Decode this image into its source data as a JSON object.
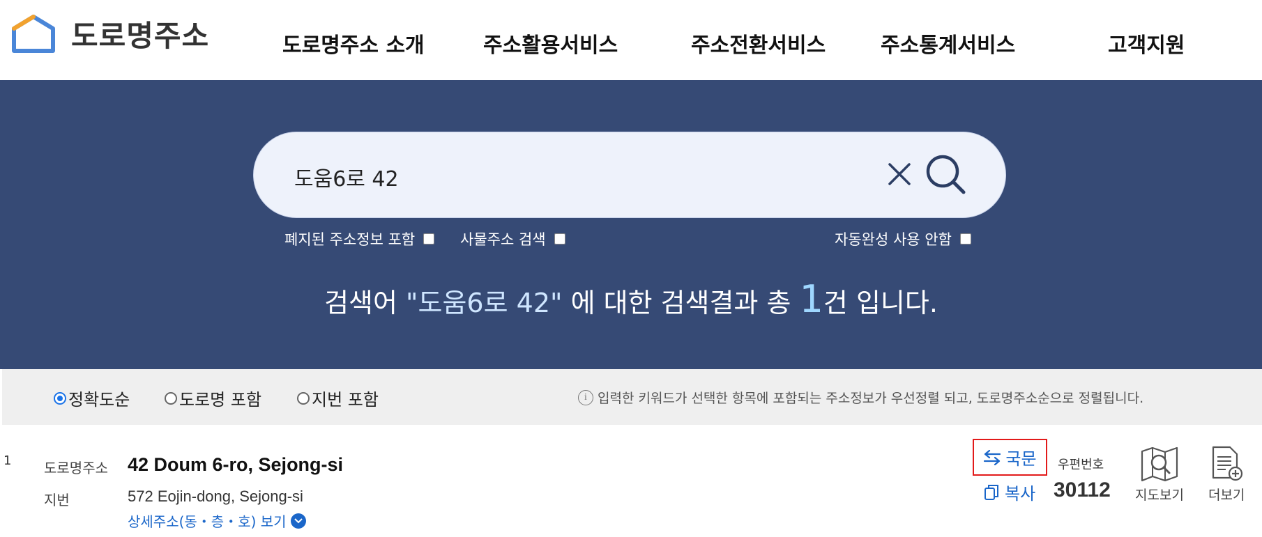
{
  "header": {
    "logo_text": "도로명주소",
    "nav": [
      "도로명주소 소개",
      "주소활용서비스",
      "주소전환서비스",
      "주소통계서비스",
      "고객지원"
    ]
  },
  "search": {
    "value": "도움6로 42",
    "options": {
      "include_abolished": "폐지된 주소정보 포함",
      "object_address": "사물주소 검색",
      "no_autocomplete": "자동완성 사용 안함"
    },
    "result_prefix": "검색어 ",
    "result_keyword": "\"도움6로 42\"",
    "result_middle": " 에 대한 검색결과 총 ",
    "result_count": "1",
    "result_suffix": "건 입니다."
  },
  "sort": {
    "options": [
      "정확도순",
      "도로명 포함",
      "지번 포함"
    ],
    "selected": "정확도순",
    "info_text": "입력한 키워드가 선택한 항목에 포함되는 주소정보가 우선정렬 되고, 도로명주소순으로 정렬됩니다."
  },
  "results": [
    {
      "num": "1",
      "road_label": "도로명주소",
      "road_address": "42 Doum 6-ro, Sejong-si",
      "jibun_label": "지번",
      "jibun_address": "572 Eojin-dong, Sejong-si",
      "detail_link": "상세주소(동・층・호) 보기",
      "kukmun_label": "국문",
      "copy_label": "복사",
      "zip_label": "우편번호",
      "zip_code": "30112",
      "map_label": "지도보기",
      "more_label": "더보기"
    }
  ],
  "colors": {
    "hero_bg": "#364a75",
    "link_blue": "#1a66c9",
    "highlight_red": "#e21a1a"
  }
}
